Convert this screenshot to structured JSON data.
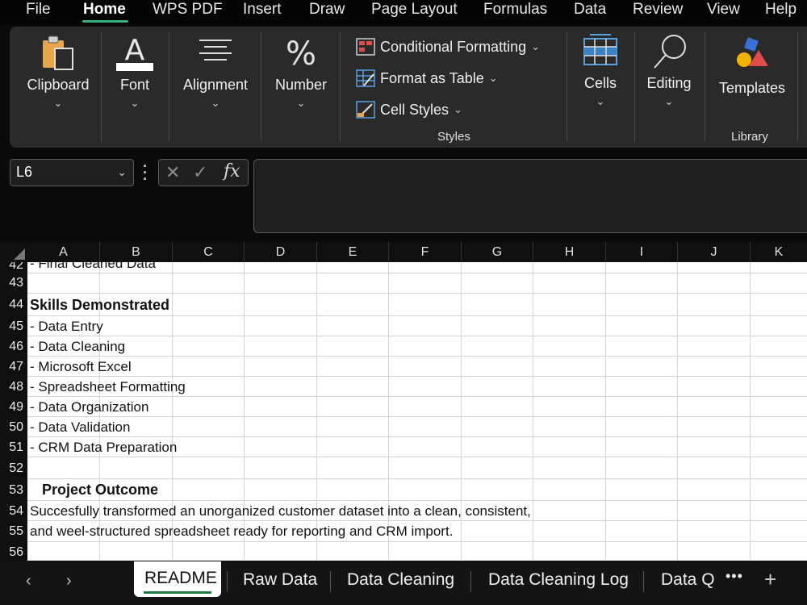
{
  "menu": [
    "File",
    "Home",
    "WPS PDF",
    "Insert",
    "Draw",
    "Page Layout",
    "Formulas",
    "Data",
    "Review",
    "View",
    "Help"
  ],
  "active_menu": "Home",
  "ribbon": {
    "clipboard": "Clipboard",
    "font": "Font",
    "alignment": "Alignment",
    "number": "Number",
    "conditional_formatting": "Conditional Formatting",
    "format_as_table": "Format as Table",
    "cell_styles": "Cell Styles",
    "styles_group": "Styles",
    "cells": "Cells",
    "editing": "Editing",
    "templates": "Templates",
    "library_group": "Library"
  },
  "formula_bar": {
    "name_box": "L6",
    "formula": ""
  },
  "columns": [
    "A",
    "B",
    "C",
    "D",
    "E",
    "F",
    "G",
    "H",
    "I",
    "J",
    "K"
  ],
  "rows": [
    {
      "num": "42",
      "text": "- Final Cleaned Data",
      "bold": false
    },
    {
      "num": "43",
      "text": "",
      "bold": false
    },
    {
      "num": "44",
      "text": "Skills Demonstrated",
      "bold": true
    },
    {
      "num": "45",
      "text": "- Data Entry",
      "bold": false
    },
    {
      "num": "46",
      "text": "- Data Cleaning",
      "bold": false
    },
    {
      "num": "47",
      "text": "- Microsoft Excel",
      "bold": false
    },
    {
      "num": "48",
      "text": "- Spreadsheet Formatting",
      "bold": false
    },
    {
      "num": "49",
      "text": "- Data Organization",
      "bold": false
    },
    {
      "num": "50",
      "text": "- Data Validation",
      "bold": false
    },
    {
      "num": "51",
      "text": "- CRM Data Preparation",
      "bold": false
    },
    {
      "num": "52",
      "text": "",
      "bold": false
    },
    {
      "num": "53",
      "text": "   Project Outcome",
      "bold": true
    },
    {
      "num": "54",
      "text": "Succesfully transformed an unorganized customer dataset into a clean, consistent,",
      "bold": false
    },
    {
      "num": "55",
      "text": "and weel-structured spreadsheet ready for reporting and CRM import.",
      "bold": false
    },
    {
      "num": "56",
      "text": "",
      "bold": false
    }
  ],
  "sheet_tabs": [
    "README",
    "Raw Data",
    "Data Cleaning",
    "Data Cleaning Log",
    "Data Q"
  ],
  "active_tab": "README",
  "colors": {
    "accent": "#36b37e",
    "ribbon_bg": "#2a2a2a",
    "tab_underline": "#1b7a44"
  }
}
